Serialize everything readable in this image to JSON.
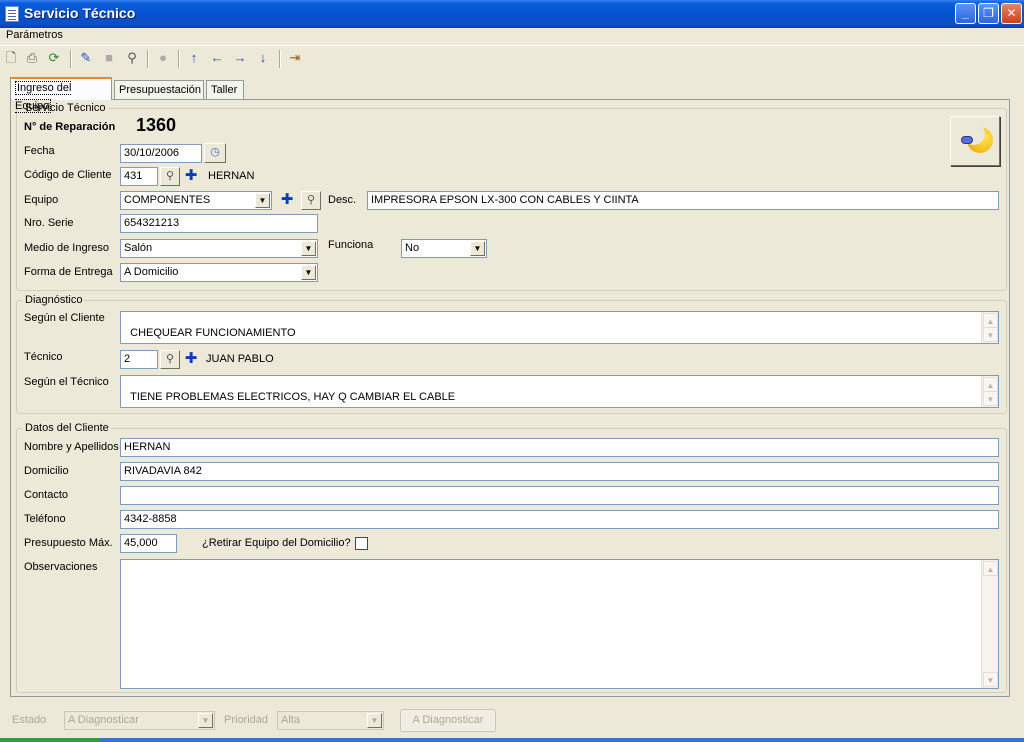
{
  "window": {
    "title": "Servicio Técnico",
    "minimize": "_",
    "restore": "❐",
    "close": "✕"
  },
  "menu": {
    "items": [
      {
        "label": "Parámetros"
      }
    ]
  },
  "toolbar": {
    "icons": [
      "new-icon",
      "print-icon",
      "refresh-icon",
      "edit-icon",
      "stop-icon",
      "search-icon",
      "record-icon",
      "arrow-up-icon",
      "arrow-left-icon",
      "arrow-right-icon",
      "arrow-down-icon",
      "exit-icon"
    ],
    "glyphs": {
      "new": "🗋",
      "print": "⎙",
      "refresh": "⟳",
      "edit": "✎",
      "stop": "■",
      "search": "⚲",
      "record": "●",
      "up": "↑",
      "left": "←",
      "right": "→",
      "down": "↓",
      "exit": "⇥"
    }
  },
  "tabs": [
    {
      "label": "Ingreso del Equipo",
      "active": true
    },
    {
      "label": "Presupuestación",
      "active": false
    },
    {
      "label": "Taller",
      "active": false
    }
  ],
  "servicio": {
    "legend": "Servicio Técnico",
    "reparacion_label": "N° de Reparación",
    "reparacion_num": "1360",
    "fecha_label": "Fecha",
    "fecha": "30/10/2006",
    "codigo_label": "Código de Cliente",
    "codigo": "431",
    "cliente_nombre": "HERNAN",
    "equipo_label": "Equipo",
    "equipo": "COMPONENTES",
    "desc_label": "Desc.",
    "desc": "IMPRESORA EPSON LX-300 CON CABLES Y CIINTA",
    "serie_label": "Nro. Serie",
    "serie": "654321213",
    "medio_label": "Medio de Ingreso",
    "medio": "Salón",
    "funciona_label": "Funciona",
    "funciona": "No",
    "forma_label": "Forma de Entrega",
    "forma": "A Domicilio"
  },
  "diagnostico": {
    "legend": "Diagnóstico",
    "cliente_label": "Según el Cliente",
    "cliente_text": "CHEQUEAR FUNCIONAMIENTO",
    "tecnico_label": "Técnico",
    "tecnico_codigo": "2",
    "tecnico_nombre": "JUAN PABLO",
    "segun_tecnico_label": "Según el Técnico",
    "segun_tecnico_text": "TIENE PROBLEMAS ELECTRICOS, HAY Q CAMBIAR EL CABLE"
  },
  "datos": {
    "legend": "Datos del Cliente",
    "nombre_label": "Nombre y Apellidos",
    "nombre": "HERNAN",
    "domicilio_label": "Domicilio",
    "domicilio": "RIVADAVIA 842",
    "contacto_label": "Contacto",
    "contacto": "",
    "telefono_label": "Teléfono",
    "telefono": "4342-8858",
    "presupuesto_label": "Presupuesto Máx.",
    "presupuesto": "45,000",
    "retirar_label": "¿Retirar Equipo del Domicilio?",
    "retirar_checked": false,
    "observaciones_label": "Observaciones",
    "observaciones": ""
  },
  "status": {
    "estado_label": "Estado",
    "estado": "A Diagnosticar",
    "prioridad_label": "Prioridad",
    "prioridad": "Alta",
    "action_label": "A Diagnosticar"
  },
  "colors": {
    "titlebar": "#0552d0",
    "window_bg": "#ece9d8",
    "field_border": "#7f9db9",
    "tab_active_accent": "#e68b2c"
  }
}
